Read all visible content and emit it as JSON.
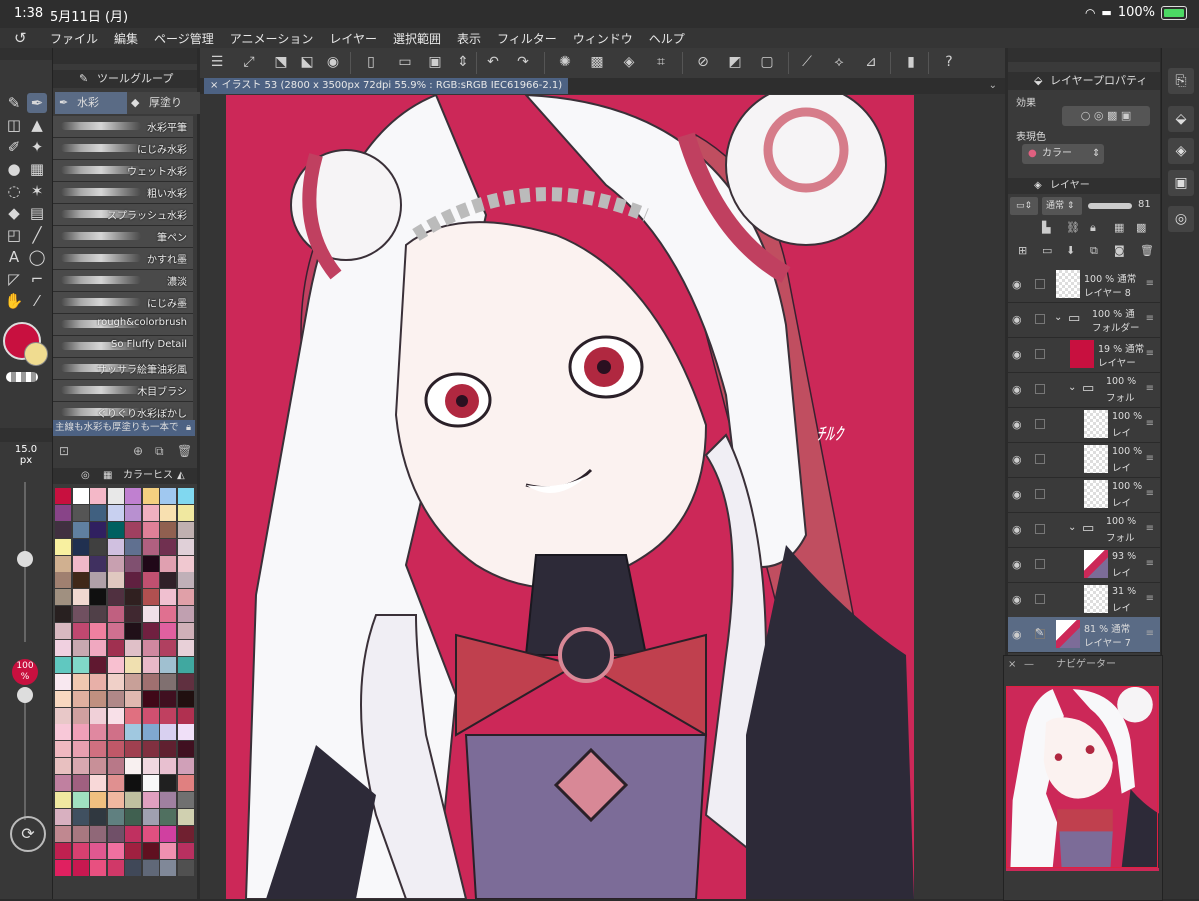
{
  "status": {
    "time": "1:38",
    "date": "5月11日 (月)",
    "battery": "100%"
  },
  "menu": [
    "ファイル",
    "編集",
    "ページ管理",
    "アニメーション",
    "レイヤー",
    "選択範囲",
    "表示",
    "フィルター",
    "ウィンドウ",
    "ヘルプ"
  ],
  "document": {
    "tab": "イラスト 53 (2800 x 3500px 72dpi 55.9% : RGB:sRGB IEC61966-2.1)"
  },
  "toolgroup": {
    "title": "ツールグループ",
    "tabs": [
      {
        "label": "水彩",
        "active": true
      },
      {
        "label": "厚塗り",
        "active": false
      }
    ],
    "brushes": [
      "水彩平筆",
      "にじみ水彩",
      "ウェット水彩",
      "粗い水彩",
      "スプラッシュ水彩",
      "筆ペン",
      "かすれ墨",
      "濃淡",
      "にじみ墨",
      "rough&colorbrush",
      "So Fluffy Detail",
      "ザッサラ絵筆油彩風",
      "木目ブラシ",
      "ぐりぐり水彩ぼかし"
    ],
    "note": "主線も水彩も厚塗りも一本で"
  },
  "brush_size": {
    "size": "15.0",
    "unit": "px",
    "opacity": "100",
    "opacity_unit": "%"
  },
  "colorset": {
    "tab1": "カラーヒス",
    "main_color": "#c8103f",
    "sub_color": "#f0dc90",
    "swatches": [
      "#c8103f",
      "#ffffff",
      "#f4b8c8",
      "#e8e8e8",
      "#c080d0",
      "#f4d080",
      "#a0c8f0",
      "#80d8f0",
      "#884488",
      "#555555",
      "#406080",
      "#c8d0f0",
      "#b890d0",
      "#f0b0c0",
      "#f8e0b0",
      "#f0e8a0",
      "#403040",
      "#6080a0",
      "#302060",
      "#006060",
      "#a04060",
      "#e08098",
      "#906050",
      "#c0b0b0",
      "#f8f0a0",
      "#203050",
      "#404040",
      "#d0c0e0",
      "#607090",
      "#b06080",
      "#703050",
      "#e0d0d8",
      "#d0b090",
      "#f0b8c8",
      "#403060",
      "#c8a0b0",
      "#805070",
      "#200818",
      "#e0a0b0",
      "#f0c8d0",
      "#a08070",
      "#402818",
      "#b0a0a8",
      "#e0c8c0",
      "#602040",
      "#c05070",
      "#302028",
      "#c0b0b8",
      "#a09080",
      "#f0d8d0",
      "#101010",
      "#503040",
      "#302020",
      "#b05050",
      "#f0c0d0",
      "#e0a0a8",
      "#282020",
      "#705060",
      "#504048",
      "#c06080",
      "#402830",
      "#f0e0e8",
      "#e07090",
      "#c0a0b0",
      "#d8b8c0",
      "#c04870",
      "#f080a0",
      "#d07090",
      "#201018",
      "#702040",
      "#e060a0",
      "#d0b0b8",
      "#f0d0e0",
      "#c8a8b0",
      "#f0a8c0",
      "#a03050",
      "#e0c0c8",
      "#d088a0",
      "#b04060",
      "#e8d0d8",
      "#60c8c0",
      "#80d8c8",
      "#601830",
      "#f8c0d0",
      "#f0e0b0",
      "#e8b8c8",
      "#a0c0d0",
      "#40a8a0",
      "#f8e8f0",
      "#f0c8b0",
      "#e8b0a8",
      "#f0d0c8",
      "#c8a098",
      "#a07070",
      "#807070",
      "#603040",
      "#f8d8c0",
      "#e0b0a0",
      "#c09080",
      "#b08888",
      "#e0b8b0",
      "#400818",
      "#401020",
      "#201010",
      "#e8c8c8",
      "#d0a0a0",
      "#f0d0d8",
      "#f8e0e8",
      "#e07080",
      "#d05070",
      "#c04060",
      "#b03050",
      "#f8c8d8",
      "#f0a0b8",
      "#e088a0",
      "#d07088",
      "#a0c8e0",
      "#80a8d0",
      "#d8d0f0",
      "#f0e0f8",
      "#f0b8c0",
      "#e8a0b0",
      "#d07080",
      "#c05868",
      "#a04050",
      "#803040",
      "#602030",
      "#401020",
      "#e8c0c0",
      "#d8a8b0",
      "#c89098",
      "#b87888",
      "#f8f0f0",
      "#f0d8e0",
      "#e8c0d0",
      "#d0a0b8",
      "#c080a0",
      "#a06080",
      "#f8d8d8",
      "#e09090",
      "#101010",
      "#f8f8f8",
      "#202020",
      "#e08080",
      "#f0e8a0",
      "#a0e0c0",
      "#f0c080",
      "#f0b8a0",
      "#c0c0a0",
      "#e0a0c0",
      "#a080a0",
      "#707070",
      "#d8b0c0",
      "#405060",
      "#303840",
      "#608080",
      "#406050",
      "#a0a0b0",
      "#507060",
      "#d0d0b0",
      "#c08890",
      "#a87880",
      "#906878",
      "#705068",
      "#c03060",
      "#e05080",
      "#d040a0",
      "#702030",
      "#c02050",
      "#d84070",
      "#e05890",
      "#f070a0",
      "#a02040",
      "#601020",
      "#f090b0",
      "#b83060",
      "#e02060",
      "#c81850",
      "#e85080",
      "#d03868",
      "#404858",
      "#606878",
      "#808898",
      "#505050"
    ]
  },
  "layer_property": {
    "title": "レイヤープロパティ",
    "effect": "効果",
    "expression_color_label": "表現色",
    "expression_color": "カラー"
  },
  "layers_panel": {
    "title": "レイヤー",
    "blend": "通常",
    "opacity": "81",
    "layers": [
      {
        "l1": "100 % 通常",
        "l2": "レイヤー 8",
        "indent": 0,
        "eye": true,
        "folder": false,
        "thumb": "trans",
        "sel": false
      },
      {
        "l1": "100 % 通",
        "l2": "フォルダー",
        "indent": 0,
        "eye": true,
        "folder": true,
        "thumb": "folder",
        "sel": false
      },
      {
        "l1": "19 % 通常",
        "l2": "レイヤー",
        "indent": 1,
        "eye": true,
        "folder": false,
        "thumb": "red",
        "sel": false
      },
      {
        "l1": "100 %",
        "l2": "フォル",
        "indent": 1,
        "eye": true,
        "folder": true,
        "thumb": "folder",
        "sel": false
      },
      {
        "l1": "100 %",
        "l2": "レイ",
        "indent": 2,
        "eye": true,
        "folder": false,
        "thumb": "trans",
        "sel": false
      },
      {
        "l1": "100 %",
        "l2": "レイ",
        "indent": 2,
        "eye": true,
        "folder": false,
        "thumb": "trans",
        "sel": false
      },
      {
        "l1": "100 %",
        "l2": "レイ",
        "indent": 2,
        "eye": true,
        "folder": false,
        "thumb": "trans",
        "sel": false
      },
      {
        "l1": "100 %",
        "l2": "フォル",
        "indent": 1,
        "eye": true,
        "folder": true,
        "thumb": "folder",
        "sel": false
      },
      {
        "l1": "93 %",
        "l2": "レイ",
        "indent": 2,
        "eye": true,
        "folder": false,
        "thumb": "art",
        "sel": false
      },
      {
        "l1": "31 %",
        "l2": "レイ",
        "indent": 2,
        "eye": true,
        "folder": false,
        "thumb": "trans",
        "sel": false
      },
      {
        "l1": "81 % 通常",
        "l2": "レイヤー 7",
        "indent": 0,
        "eye": true,
        "folder": false,
        "thumb": "art",
        "sel": true
      }
    ]
  },
  "navigator": {
    "title": "ナビゲーター"
  }
}
